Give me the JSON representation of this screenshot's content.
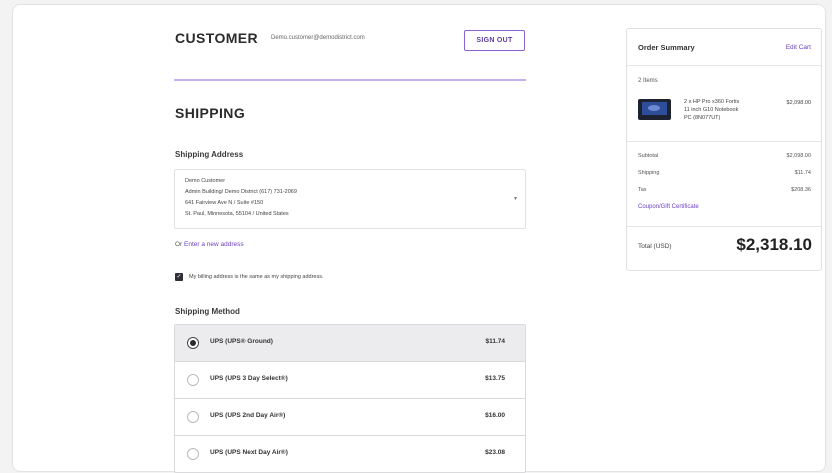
{
  "customer": {
    "title": "CUSTOMER",
    "email": "Demo.customer@demodistrict.com",
    "sign_out": "SIGN OUT"
  },
  "shipping": {
    "title": "SHIPPING",
    "address_label": "Shipping Address",
    "address_lines": [
      "Demo Customer",
      "Admin Building/ Demo District (617) 731-2069",
      "641 Fairview Ave N / Suite #150",
      "St. Paul, Minnesota, 55104 / United States"
    ],
    "or_text": "Or",
    "new_address_link": "Enter a new address",
    "billing_same_label": "My billing address is the same as my shipping address.",
    "method_label": "Shipping Method",
    "methods": [
      {
        "name": "UPS (UPS® Ground)",
        "price": "$11.74",
        "selected": true
      },
      {
        "name": "UPS (UPS 3 Day Select®)",
        "price": "$13.75",
        "selected": false
      },
      {
        "name": "UPS (UPS 2nd Day Air®)",
        "price": "$16.00",
        "selected": false
      },
      {
        "name": "UPS (UPS Next Day Air®)",
        "price": "$23.08",
        "selected": false
      }
    ]
  },
  "summary": {
    "title": "Order Summary",
    "edit_cart": "Edit Cart",
    "items_count": "2 Items",
    "product_lines": [
      "2 x HP Pro x360 Fortis",
      "11 inch G10 Notebook",
      "PC (8N077UT)"
    ],
    "product_price": "$2,098.00",
    "rows": [
      {
        "label": "Subtotal",
        "value": "$2,098.00"
      },
      {
        "label": "Shipping",
        "value": "$11.74"
      },
      {
        "label": "Tax",
        "value": "$208.36"
      }
    ],
    "coupon_link": "Coupon/Gift Certificate",
    "total_label": "Total (USD)",
    "total_value": "$2,318.10"
  },
  "colors": {
    "accent": "#6a42c2",
    "divider": "#c3b2ec"
  }
}
